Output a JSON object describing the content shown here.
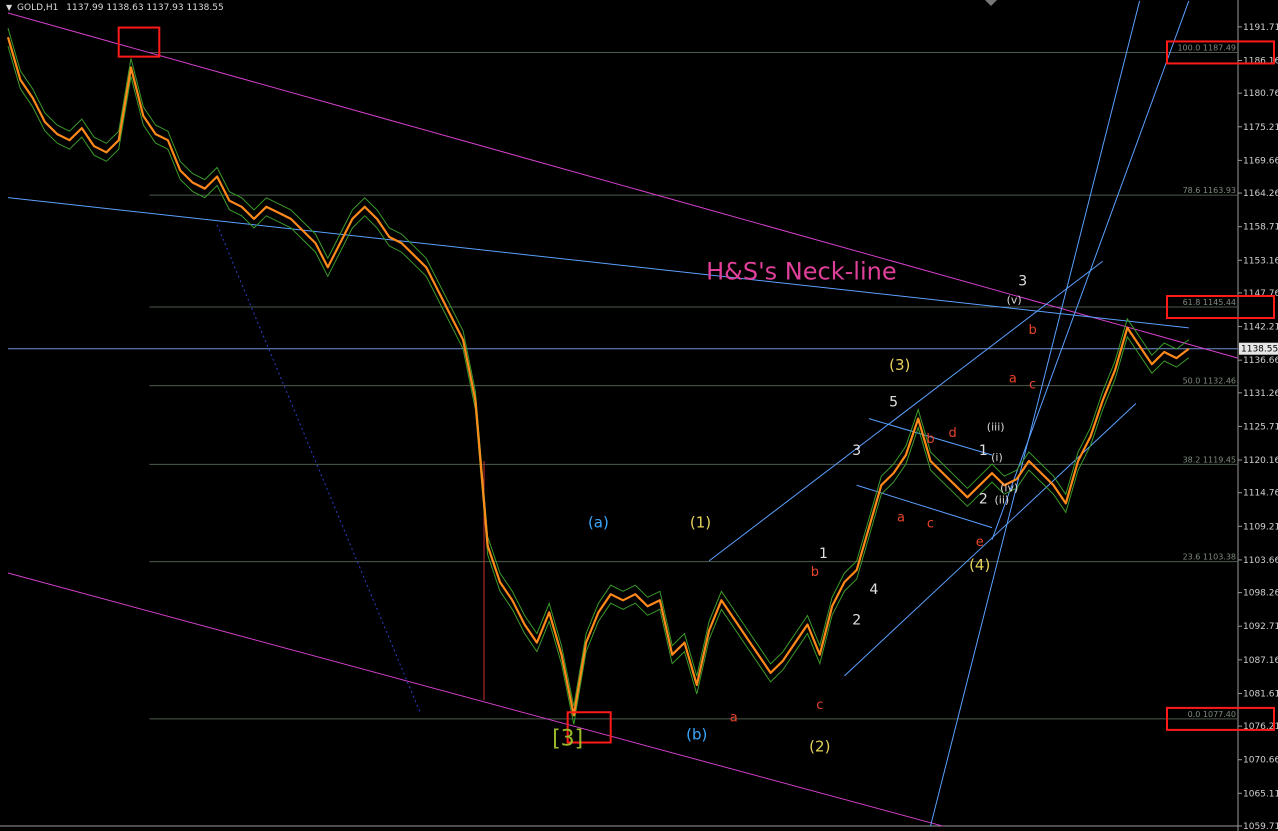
{
  "header": {
    "symbol": "GOLD,H1",
    "ohlc": "1137.99 1138.63 1137.93 1138.55"
  },
  "colors": {
    "background": "#000000",
    "price": "#ff8a1c",
    "envelope": "#3a9a2a",
    "fib": "#4e5b4e",
    "channel": "#5aa0ff",
    "magenta": "#d23fc8",
    "highlight": "#ff1a1a",
    "grid_text": "#cfcfcf"
  },
  "chart_data": {
    "type": "line",
    "title": "",
    "xlabel": "",
    "ylabel": "",
    "ylim": [
      1059.71,
      1194.5
    ],
    "y_ticks": [
      "1191.71",
      "1186.16",
      "1180.76",
      "1175.21",
      "1169.66",
      "1164.26",
      "1158.71",
      "1153.16",
      "1147.76",
      "1142.21",
      "1136.66",
      "1131.26",
      "1125.71",
      "1120.16",
      "1114.76",
      "1109.21",
      "1103.66",
      "1098.26",
      "1092.71",
      "1087.16",
      "1081.61",
      "1076.21",
      "1070.66",
      "1065.11",
      "1059.71"
    ],
    "current_price_label": "1138.55",
    "current_price": 1138.55,
    "x_range": [
      0,
      100
    ],
    "series": [
      {
        "x": [
          0,
          1,
          2,
          3,
          4,
          5,
          6,
          7,
          8,
          9,
          10,
          11,
          12,
          13,
          14,
          15,
          16,
          17,
          18,
          19,
          20,
          21,
          22,
          23,
          24,
          25,
          26,
          27,
          28,
          29,
          30,
          31,
          32,
          33,
          34,
          35,
          36,
          37,
          38,
          39,
          40,
          41,
          42,
          43,
          44,
          45,
          46,
          47,
          48,
          49,
          50,
          51,
          52,
          53,
          54,
          55,
          56,
          57,
          58,
          59,
          60,
          61,
          62,
          63,
          64,
          65,
          66,
          67,
          68,
          69,
          70,
          71,
          72,
          73,
          74,
          75,
          76,
          77,
          78,
          79,
          80,
          81,
          82,
          83,
          84,
          85,
          86,
          87,
          88,
          89,
          90,
          91,
          92,
          93,
          94,
          95,
          96
        ],
        "values": [
          1190,
          1183,
          1180,
          1176,
          1174,
          1173,
          1175,
          1172,
          1171,
          1173,
          1185,
          1177,
          1174,
          1173,
          1168,
          1166,
          1165,
          1167,
          1163,
          1162,
          1160,
          1162,
          1161,
          1160,
          1158,
          1156,
          1152,
          1156,
          1160,
          1162,
          1160,
          1157,
          1156,
          1154,
          1152,
          1148,
          1144,
          1140,
          1130,
          1106,
          1100,
          1097,
          1093,
          1090,
          1095,
          1088,
          1078,
          1090,
          1095,
          1098,
          1097,
          1098,
          1096,
          1097,
          1088,
          1090,
          1083,
          1092,
          1097,
          1094,
          1091,
          1088,
          1085,
          1087,
          1090,
          1093,
          1088,
          1096,
          1100,
          1102,
          1109,
          1116,
          1118,
          1121,
          1127,
          1120,
          1118,
          1116,
          1114,
          1116,
          1118,
          1116,
          1117,
          1120,
          1118,
          1116,
          1113,
          1120,
          1124,
          1130,
          1135,
          1142,
          1139,
          1136,
          1138,
          1137,
          1138.55
        ]
      }
    ],
    "fib_levels": [
      {
        "label": "100.0 1187.49",
        "value": 1187.49
      },
      {
        "label": "78.6 1163.93",
        "value": 1163.93
      },
      {
        "label": "61.8 1145.44",
        "value": 1145.44
      },
      {
        "label": "50.0 1132.46",
        "value": 1132.46
      },
      {
        "label": "38.2 1119.45",
        "value": 1119.45
      },
      {
        "label": "23.6 1103.38",
        "value": 1103.38
      },
      {
        "label": "0.0 1077.40",
        "value": 1077.4
      }
    ],
    "annotations": [
      {
        "text": "H&S's Neck-line",
        "color": "#e0409a",
        "x": 64.5,
        "y": 1150,
        "size": 24
      },
      {
        "text": "[3]",
        "color": "#9ab82a",
        "x": 45.5,
        "y": 1073,
        "size": 22
      },
      {
        "text": "(a)",
        "color": "#3aa8ff",
        "x": 48,
        "y": 1109,
        "size": 15
      },
      {
        "text": "(b)",
        "color": "#3aa8ff",
        "x": 56,
        "y": 1074,
        "size": 15
      },
      {
        "text": "(1)",
        "color": "#e6d25a",
        "x": 56.3,
        "y": 1109,
        "size": 15
      },
      {
        "text": "(2)",
        "color": "#e6d25a",
        "x": 66,
        "y": 1072,
        "size": 15
      },
      {
        "text": "(3)",
        "color": "#e6d25a",
        "x": 72.5,
        "y": 1135,
        "size": 15
      },
      {
        "text": "(4)",
        "color": "#e6d25a",
        "x": 79,
        "y": 1102,
        "size": 15
      },
      {
        "text": "1",
        "color": "#e0e0e0",
        "x": 66.3,
        "y": 1104,
        "size": 14
      },
      {
        "text": "2",
        "color": "#e0e0e0",
        "x": 69,
        "y": 1093,
        "size": 14
      },
      {
        "text": "3",
        "color": "#e0e0e0",
        "x": 69,
        "y": 1121,
        "size": 14
      },
      {
        "text": "4",
        "color": "#e0e0e0",
        "x": 70.4,
        "y": 1098,
        "size": 14
      },
      {
        "text": "5",
        "color": "#e0e0e0",
        "x": 72,
        "y": 1129,
        "size": 14
      },
      {
        "text": "1",
        "color": "#e0e0e0",
        "x": 79.3,
        "y": 1121,
        "size": 14
      },
      {
        "text": "2",
        "color": "#e0e0e0",
        "x": 79.3,
        "y": 1113,
        "size": 14
      },
      {
        "text": "3",
        "color": "#e0e0e0",
        "x": 82.5,
        "y": 1149,
        "size": 14
      },
      {
        "text": "a",
        "color": "#e8432c",
        "x": 59,
        "y": 1077,
        "size": 13
      },
      {
        "text": "b",
        "color": "#e8432c",
        "x": 65.6,
        "y": 1101,
        "size": 13
      },
      {
        "text": "c",
        "color": "#e8432c",
        "x": 66,
        "y": 1079,
        "size": 13
      },
      {
        "text": "a",
        "color": "#e8432c",
        "x": 72.6,
        "y": 1110,
        "size": 13
      },
      {
        "text": "b",
        "color": "#e8432c",
        "x": 75,
        "y": 1123,
        "size": 13
      },
      {
        "text": "c",
        "color": "#e8432c",
        "x": 75,
        "y": 1109,
        "size": 13
      },
      {
        "text": "d",
        "color": "#e8432c",
        "x": 76.8,
        "y": 1124,
        "size": 13
      },
      {
        "text": "e",
        "color": "#e8432c",
        "x": 79,
        "y": 1106,
        "size": 13
      },
      {
        "text": "a",
        "color": "#e8432c",
        "x": 81.7,
        "y": 1133,
        "size": 13
      },
      {
        "text": "b",
        "color": "#e8432c",
        "x": 83.3,
        "y": 1141,
        "size": 13
      },
      {
        "text": "c",
        "color": "#e8432c",
        "x": 83.3,
        "y": 1132,
        "size": 13
      },
      {
        "text": "(v)",
        "color": "#d8d8d8",
        "x": 81.8,
        "y": 1146,
        "size": 11
      },
      {
        "text": "(iii)",
        "color": "#d8d8d8",
        "x": 80.3,
        "y": 1125,
        "size": 11
      },
      {
        "text": "(i)",
        "color": "#d8d8d8",
        "x": 80.4,
        "y": 1120,
        "size": 11
      },
      {
        "text": "(iv)",
        "color": "#d8d8d8",
        "x": 81.4,
        "y": 1115,
        "size": 11
      },
      {
        "text": "(ii)",
        "color": "#d8d8d8",
        "x": 80.8,
        "y": 1113,
        "size": 11
      }
    ],
    "boxes": [
      {
        "name": "top-high-box",
        "x": [
          9,
          12.3
        ],
        "y": [
          1191.6,
          1186.8
        ]
      },
      {
        "name": "bottom-low-box",
        "x": [
          45.5,
          49
        ],
        "y": [
          1078.5,
          1073.5
        ]
      },
      {
        "name": "fib-100-box",
        "axis_value": 1187.49
      },
      {
        "name": "fib-61-box",
        "axis_value": 1145.44
      },
      {
        "name": "fib-0-box",
        "axis_value": 1077.4
      }
    ],
    "trendlines": [
      {
        "name": "upper-magenta-line",
        "color": "#d23fc8",
        "x": [
          0,
          100
        ],
        "y": [
          1194.0,
          1137.0
        ]
      },
      {
        "name": "lower-magenta-line",
        "color": "#d23fc8",
        "x": [
          0,
          76
        ],
        "y": [
          1101.5,
          1059.7
        ]
      },
      {
        "name": "neckline-blue",
        "color": "#5aa0ff",
        "x": [
          0,
          96
        ],
        "y": [
          1163.5,
          1142.0
        ]
      },
      {
        "name": "channel-top",
        "color": "#5aa0ff",
        "x": [
          57,
          89
        ],
        "y": [
          1103.5,
          1153.0
        ]
      },
      {
        "name": "channel-bottom",
        "color": "#5aa0ff",
        "x": [
          68,
          91.7
        ],
        "y": [
          1084.5,
          1129.5
        ]
      },
      {
        "name": "triangle-top",
        "color": "#5aa0ff",
        "x": [
          70,
          80
        ],
        "y": [
          1127.0,
          1121.0
        ]
      },
      {
        "name": "triangle-bottom",
        "color": "#5aa0ff",
        "x": [
          69,
          80
        ],
        "y": [
          1116.0,
          1109.0
        ]
      },
      {
        "name": "steep-line-1",
        "color": "#5aa0ff",
        "x": [
          75,
          92
        ],
        "y": [
          1059.7,
          1196.0
        ]
      },
      {
        "name": "steep-line-2",
        "color": "#5aa0ff",
        "x": [
          80,
          96
        ],
        "y": [
          1107.0,
          1196.0
        ]
      },
      {
        "name": "dashed-diagonal",
        "color": "#2a40c8",
        "x": [
          17,
          33.5
        ],
        "y": [
          1159.0,
          1078.5
        ]
      },
      {
        "name": "red-vertical",
        "color": "#c83030",
        "x": [
          38.7,
          38.7
        ],
        "y": [
          1120.0,
          1080.5
        ]
      }
    ]
  }
}
